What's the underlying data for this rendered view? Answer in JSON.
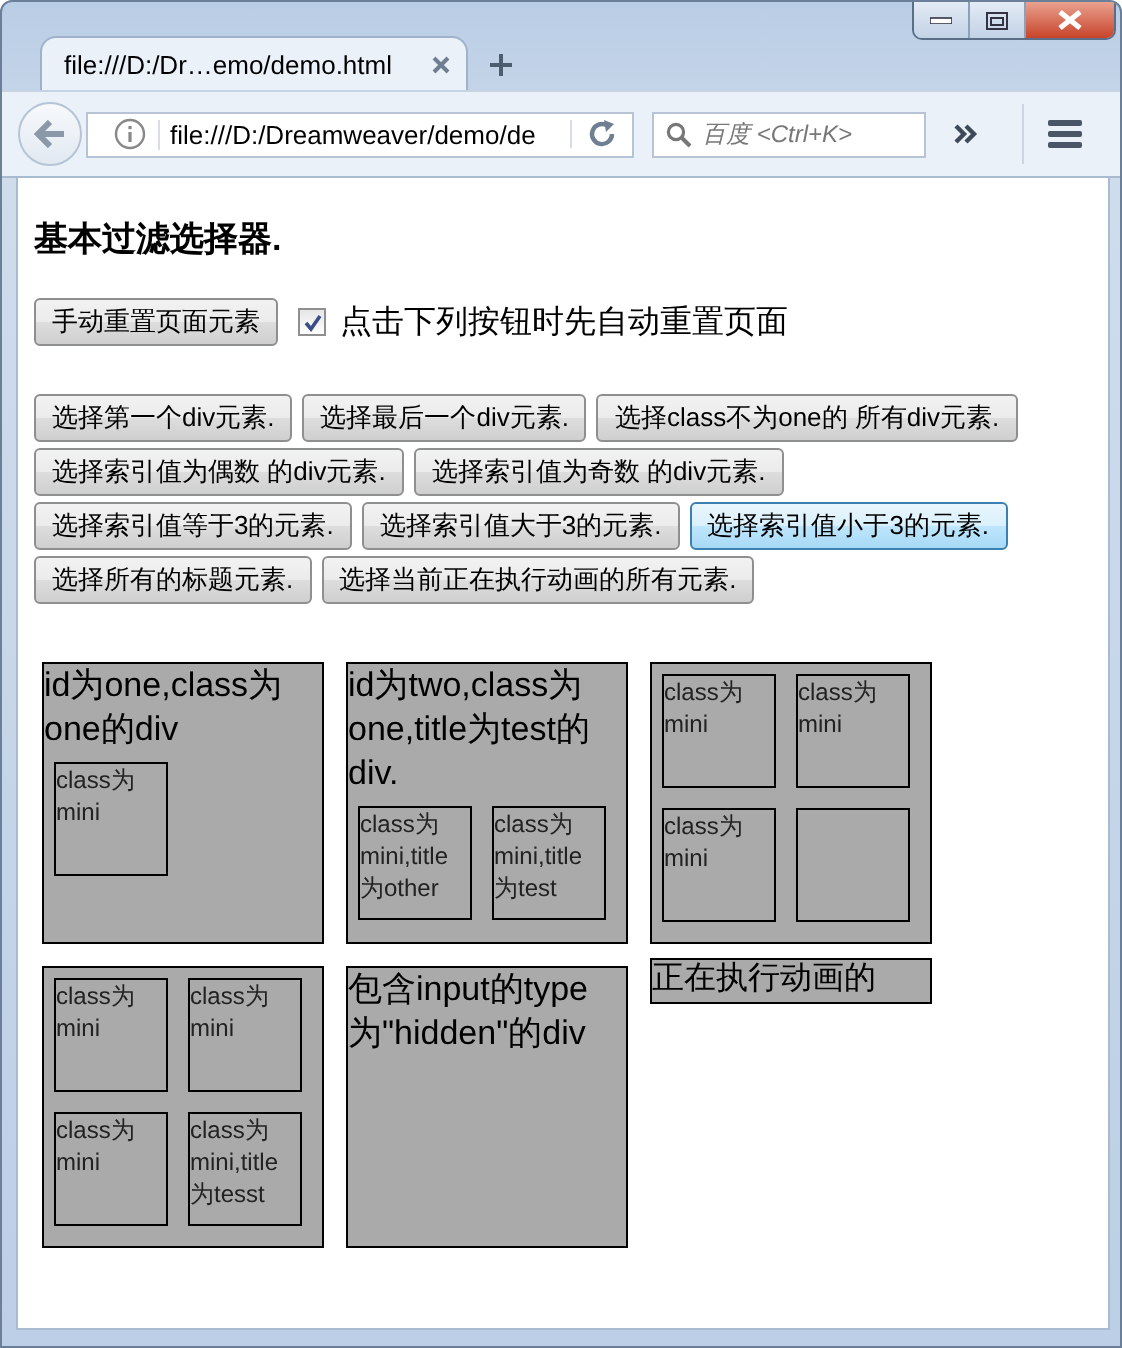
{
  "browser": {
    "tab_title": "file:///D:/Dr…emo/demo.html",
    "url": "file:///D:/Dreamweaver/demo/de",
    "search_placeholder": "百度 <Ctrl+K>"
  },
  "page": {
    "heading": "基本过滤选择器.",
    "reset_button": "手动重置页面元素",
    "auto_reset": {
      "label": "点击下列按钮时先自动重置页面",
      "checked": true
    },
    "filter_buttons": [
      {
        "label": "选择第一个div元素.",
        "hovered": false
      },
      {
        "label": "选择最后一个div元素.",
        "hovered": false
      },
      {
        "label": "选择class不为one的 所有div元素.",
        "hovered": false
      },
      {
        "label": "选择索引值为偶数 的div元素.",
        "hovered": false
      },
      {
        "label": "选择索引值为奇数 的div元素.",
        "hovered": false
      },
      {
        "label": "选择索引值等于3的元素.",
        "hovered": false
      },
      {
        "label": "选择索引值大于3的元素.",
        "hovered": false
      },
      {
        "label": "选择索引值小于3的元素.",
        "hovered": true
      },
      {
        "label": "选择所有的标题元素.",
        "hovered": false
      },
      {
        "label": "选择当前正在执行动画的所有元素.",
        "hovered": false
      }
    ],
    "boxes": [
      {
        "kind": "large",
        "text": "id为one,class为one的div",
        "minis": [
          {
            "text": "class为mini"
          }
        ]
      },
      {
        "kind": "large",
        "text": "id为two,class为one,title为test的div.",
        "minis": [
          {
            "text": "class为mini,title为other"
          },
          {
            "text": "class为mini,title为test"
          }
        ]
      },
      {
        "kind": "large",
        "minis": [
          {
            "kind": "text",
            "text": "class为mini"
          },
          {
            "kind": "text",
            "text": "class为mini"
          },
          {
            "kind": "text",
            "text": "class为mini"
          },
          {
            "kind": "blank"
          }
        ]
      },
      {
        "kind": "large",
        "minis": [
          {
            "text": "class为mini"
          },
          {
            "text": "class为mini"
          },
          {
            "text": "class为mini"
          },
          {
            "text": "class为mini,title为tesst"
          }
        ]
      },
      {
        "kind": "large",
        "text": "包含input的type为\"hidden\"的div"
      },
      {
        "kind": "short",
        "text": "正在执行动画的"
      }
    ]
  }
}
